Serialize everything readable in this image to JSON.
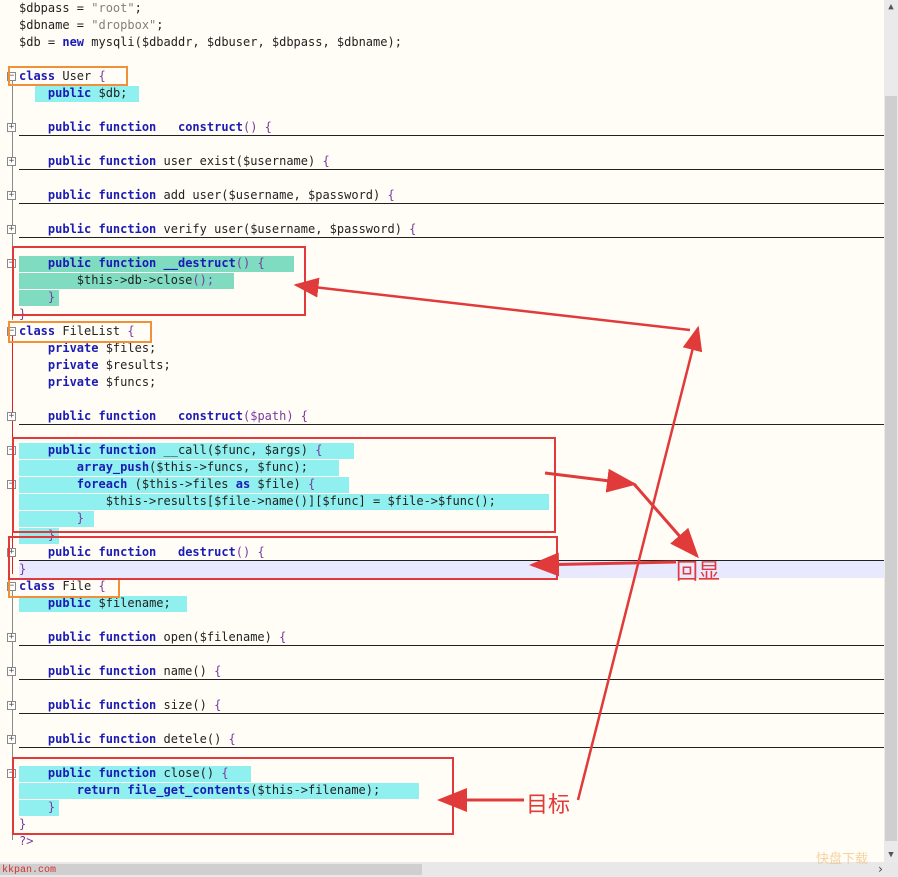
{
  "lines": [
    [
      [
        "var",
        "$dbpass = "
      ],
      [
        "str",
        "\"root\""
      ],
      [
        "var",
        ";"
      ]
    ],
    [
      [
        "var",
        "$dbname = "
      ],
      [
        "str",
        "\"dropbox\""
      ],
      [
        "var",
        ";"
      ]
    ],
    [
      [
        "var",
        "$db = "
      ],
      [
        "kw",
        "new"
      ],
      [
        "var",
        " mysqli($dbaddr, $dbuser, $dbpass, $dbname);"
      ]
    ],
    [],
    [
      [
        "kw",
        "class"
      ],
      [
        "var",
        " User "
      ],
      [
        "op",
        "{"
      ]
    ],
    [
      [
        "var",
        "    "
      ],
      [
        "kw",
        "public"
      ],
      [
        "var",
        " $db;"
      ]
    ],
    [],
    [
      [
        "var",
        "    "
      ],
      [
        "kw",
        "public function"
      ],
      [
        "var",
        "   "
      ],
      [
        "kw",
        "construct"
      ],
      [
        "op",
        "() {"
      ]
    ],
    [],
    [
      [
        "var",
        "    "
      ],
      [
        "kw",
        "public function"
      ],
      [
        "var",
        " user exist($username) "
      ],
      [
        "op",
        "{"
      ]
    ],
    [],
    [
      [
        "var",
        "    "
      ],
      [
        "kw",
        "public function"
      ],
      [
        "var",
        " add user($username, $password) "
      ],
      [
        "op",
        "{"
      ]
    ],
    [],
    [
      [
        "var",
        "    "
      ],
      [
        "kw",
        "public function"
      ],
      [
        "var",
        " verify user($username, $password) "
      ],
      [
        "op",
        "{"
      ]
    ],
    [],
    [
      [
        "var",
        "    "
      ],
      [
        "kw",
        "public function"
      ],
      [
        "var",
        " "
      ],
      [
        "kw",
        "__destruct"
      ],
      [
        "op",
        "() {"
      ]
    ],
    [
      [
        "var",
        "        $this->db->close"
      ],
      [
        "op",
        "();"
      ]
    ],
    [
      [
        "var",
        "    "
      ],
      [
        "op",
        "}"
      ]
    ],
    [
      [
        "op",
        "}"
      ]
    ],
    [
      [
        "kw",
        "class"
      ],
      [
        "var",
        " FileList "
      ],
      [
        "op",
        "{"
      ]
    ],
    [
      [
        "var",
        "    "
      ],
      [
        "kw",
        "private"
      ],
      [
        "var",
        " $files;"
      ]
    ],
    [
      [
        "var",
        "    "
      ],
      [
        "kw",
        "private"
      ],
      [
        "var",
        " $results;"
      ]
    ],
    [
      [
        "var",
        "    "
      ],
      [
        "kw",
        "private"
      ],
      [
        "var",
        " $funcs;"
      ]
    ],
    [],
    [
      [
        "var",
        "    "
      ],
      [
        "kw",
        "public function"
      ],
      [
        "var",
        "   "
      ],
      [
        "kw",
        "construct"
      ],
      [
        "op",
        "($path) {"
      ]
    ],
    [],
    [
      [
        "var",
        "    "
      ],
      [
        "kw",
        "public function"
      ],
      [
        "var",
        " __call($func, $args) "
      ],
      [
        "op",
        "{"
      ]
    ],
    [
      [
        "var",
        "        "
      ],
      [
        "kw",
        "array_push"
      ],
      [
        "var",
        "($this->funcs, $func);"
      ]
    ],
    [
      [
        "var",
        "        "
      ],
      [
        "kw",
        "foreach"
      ],
      [
        "var",
        " ($this->files "
      ],
      [
        "kw",
        "as"
      ],
      [
        "var",
        " $file) "
      ],
      [
        "op",
        "{"
      ]
    ],
    [
      [
        "var",
        "            $this->results[$file->name()][$func] = $file->$func();"
      ]
    ],
    [
      [
        "var",
        "        "
      ],
      [
        "op",
        "}"
      ]
    ],
    [
      [
        "var",
        "    "
      ],
      [
        "op",
        "}"
      ]
    ],
    [
      [
        "var",
        "    "
      ],
      [
        "kw",
        "public function"
      ],
      [
        "var",
        "   "
      ],
      [
        "kw",
        "destruct"
      ],
      [
        "op",
        "() {"
      ]
    ],
    [
      [
        "op",
        "}"
      ]
    ],
    [
      [
        "kw",
        "class"
      ],
      [
        "var",
        " File "
      ],
      [
        "op",
        "{"
      ]
    ],
    [
      [
        "var",
        "    "
      ],
      [
        "kw",
        "public"
      ],
      [
        "var",
        " $filename;"
      ]
    ],
    [],
    [
      [
        "var",
        "    "
      ],
      [
        "kw",
        "public function"
      ],
      [
        "var",
        " open($filename) "
      ],
      [
        "op",
        "{"
      ]
    ],
    [],
    [
      [
        "var",
        "    "
      ],
      [
        "kw",
        "public function"
      ],
      [
        "var",
        " name() "
      ],
      [
        "op",
        "{"
      ]
    ],
    [],
    [
      [
        "var",
        "    "
      ],
      [
        "kw",
        "public function"
      ],
      [
        "var",
        " size() "
      ],
      [
        "op",
        "{"
      ]
    ],
    [],
    [
      [
        "var",
        "    "
      ],
      [
        "kw",
        "public function"
      ],
      [
        "var",
        " detele() "
      ],
      [
        "op",
        "{"
      ]
    ],
    [],
    [
      [
        "var",
        "    "
      ],
      [
        "kw",
        "public function"
      ],
      [
        "var",
        " close() "
      ],
      [
        "op",
        "{"
      ]
    ],
    [
      [
        "var",
        "        "
      ],
      [
        "kw",
        "return file_get_contents"
      ],
      [
        "var",
        "($this->filename);"
      ]
    ],
    [
      [
        "var",
        "    "
      ],
      [
        "op",
        "}"
      ]
    ],
    [
      [
        "op",
        "}"
      ]
    ],
    [
      [
        "op",
        "?>"
      ]
    ]
  ],
  "annotations": {
    "echo_label": "回显",
    "target_label": "目标"
  },
  "footer": {
    "site": "kkpan.com",
    "watermark": "快盘下载"
  },
  "colors": {
    "keyword": "#1b1bb5",
    "highlight": "#8ff0ef",
    "annotation_red": "#e03a3a",
    "class_box_orange": "#f0903a"
  }
}
